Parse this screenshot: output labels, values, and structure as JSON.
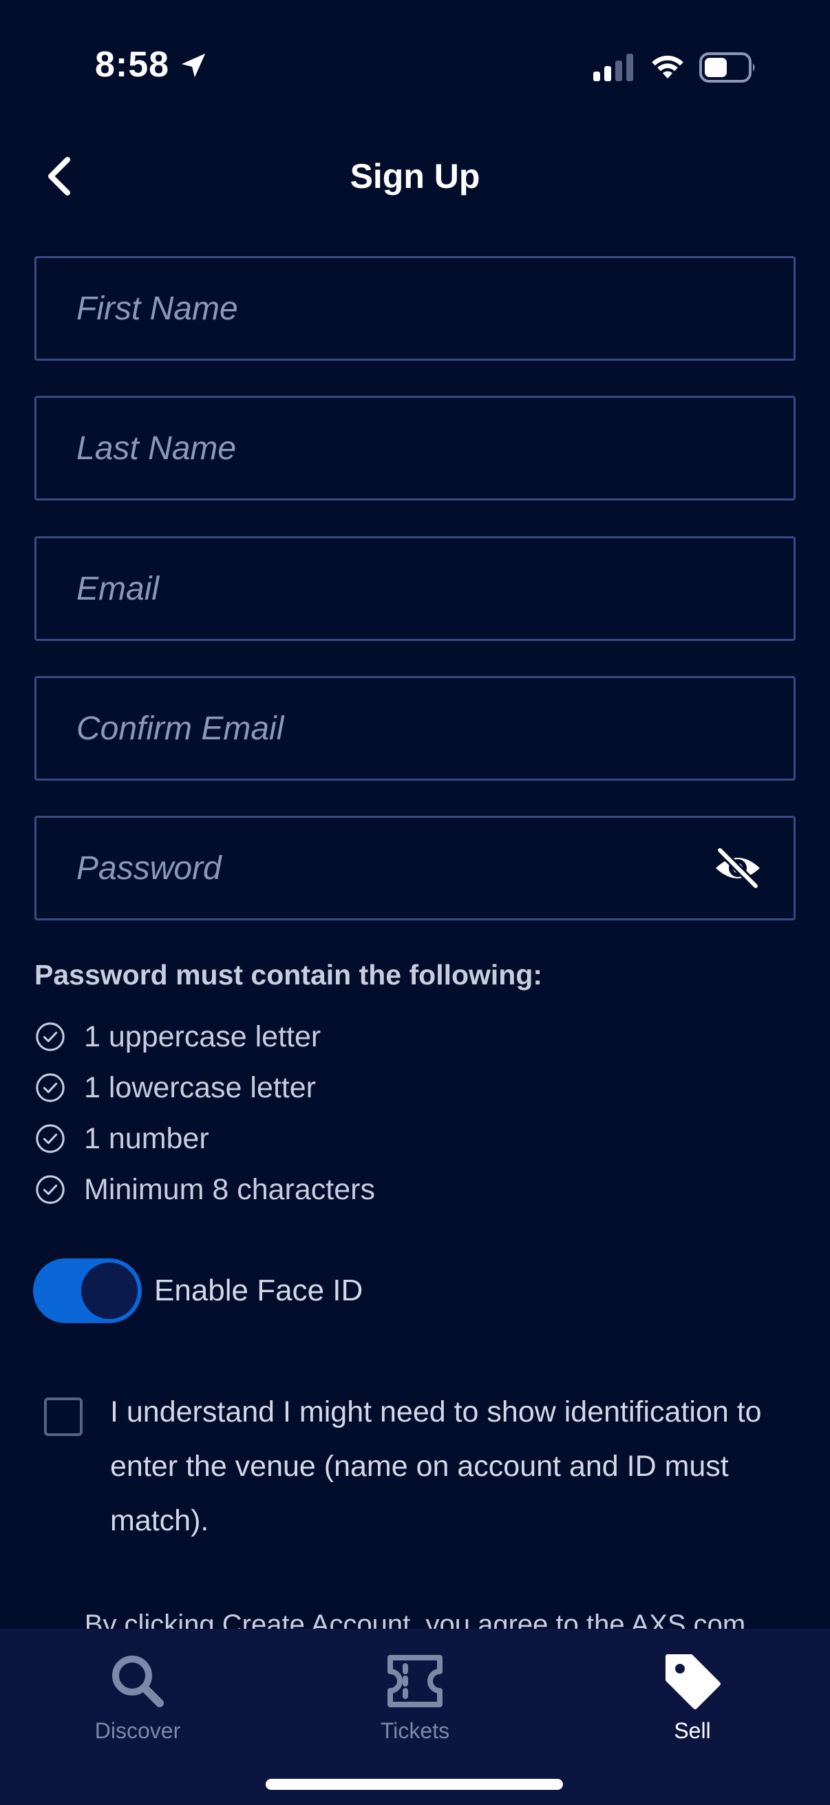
{
  "status_bar": {
    "time": "8:58"
  },
  "header": {
    "title": "Sign Up"
  },
  "form": {
    "first_name_placeholder": "First Name",
    "last_name_placeholder": "Last Name",
    "email_placeholder": "Email",
    "confirm_email_placeholder": "Confirm Email",
    "password_placeholder": "Password"
  },
  "password_rules": {
    "title": "Password must contain the following:",
    "items": [
      "1 uppercase letter",
      "1 lowercase letter",
      "1 number",
      "Minimum 8 characters"
    ]
  },
  "face_id": {
    "label": "Enable Face ID",
    "enabled": true
  },
  "consent": {
    "text": "I understand I might need to show identification to enter the venue (name on account and ID must match).",
    "checked": false
  },
  "terms": {
    "text": "By clicking Create Account, you agree to the AXS.com"
  },
  "tabs": [
    {
      "label": "Discover",
      "icon": "search-icon",
      "active": false
    },
    {
      "label": "Tickets",
      "icon": "ticket-icon",
      "active": false
    },
    {
      "label": "Sell",
      "icon": "tag-icon",
      "active": true
    }
  ],
  "colors": {
    "background": "#020c2b",
    "accent": "#0b66d8",
    "tabbar": "#0b1540",
    "field_border": "#3a4a86"
  }
}
